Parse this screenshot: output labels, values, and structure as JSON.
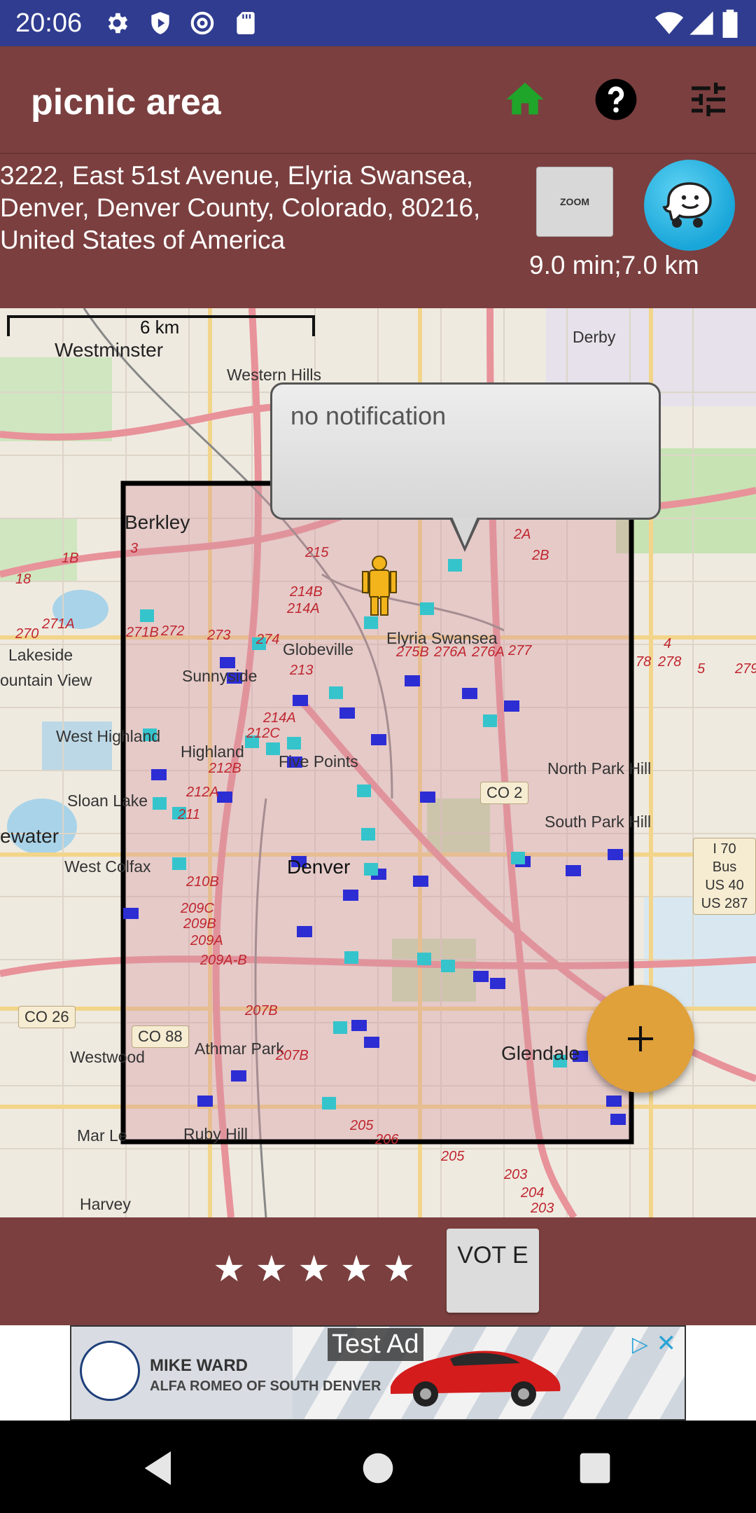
{
  "status_bar": {
    "time": "20:06",
    "icons": [
      "settings-icon",
      "shield-icon",
      "at-sign-icon",
      "sd-card-icon",
      "wifi-icon",
      "signal-icon",
      "battery-icon"
    ]
  },
  "app_bar": {
    "title": "picnic area",
    "actions": [
      "home-icon",
      "help-icon",
      "tune-icon"
    ],
    "home_color": "#1fa52a"
  },
  "location": {
    "address": "3222, East 51st Avenue, Elyria Swansea, Denver, Denver County, Colorado, 80216, United States of America",
    "zoom_label": "ZOOM",
    "route_info": "9.0 min;7.0 km"
  },
  "map": {
    "scale_label": "6 km",
    "notification": "no notification",
    "places": [
      "Westminster",
      "Western Hills",
      "Derby",
      "Berkley",
      "Lakeside",
      "ountain View",
      "Sunnyside",
      "Globeville",
      "Elyria Swansea",
      "West Highland",
      "Highland",
      "Five Points",
      "North Park Hill",
      "South Park Hill",
      "Sloan Lake",
      "ewater",
      "West Colfax",
      "Denver",
      "Westwood",
      "Athmar Park",
      "Glendale",
      "Ruby Hill",
      "Mar Le",
      "Harvey"
    ],
    "road_numbers": [
      "215",
      "214B",
      "214A",
      "274",
      "273",
      "272",
      "271B",
      "271A",
      "270",
      "1B",
      "18",
      "3",
      "275B",
      "276A",
      "276A",
      "277",
      "2A",
      "2B",
      "4",
      "278",
      "5",
      "279",
      "213",
      "214A",
      "212C",
      "212B",
      "212A",
      "211",
      "210B",
      "209C",
      "209B",
      "209A",
      "209A-B",
      "207B",
      "207B",
      "205",
      "206",
      "205",
      "203",
      "204",
      "203",
      "78"
    ],
    "shields": [
      "CO 2",
      "CO 26",
      "CO 88",
      "I 70 Bus",
      "US 40",
      "US 287"
    ]
  },
  "rating": {
    "stars": "★★★★★",
    "vote_label": "VOT E"
  },
  "ad": {
    "tag": "Test Ad",
    "line1": "MIKE WARD",
    "line2": "ALFA ROMEO OF SOUTH DENVER"
  },
  "nav_bar": {
    "buttons": [
      "back-icon",
      "home-circle-icon",
      "recents-icon"
    ]
  }
}
